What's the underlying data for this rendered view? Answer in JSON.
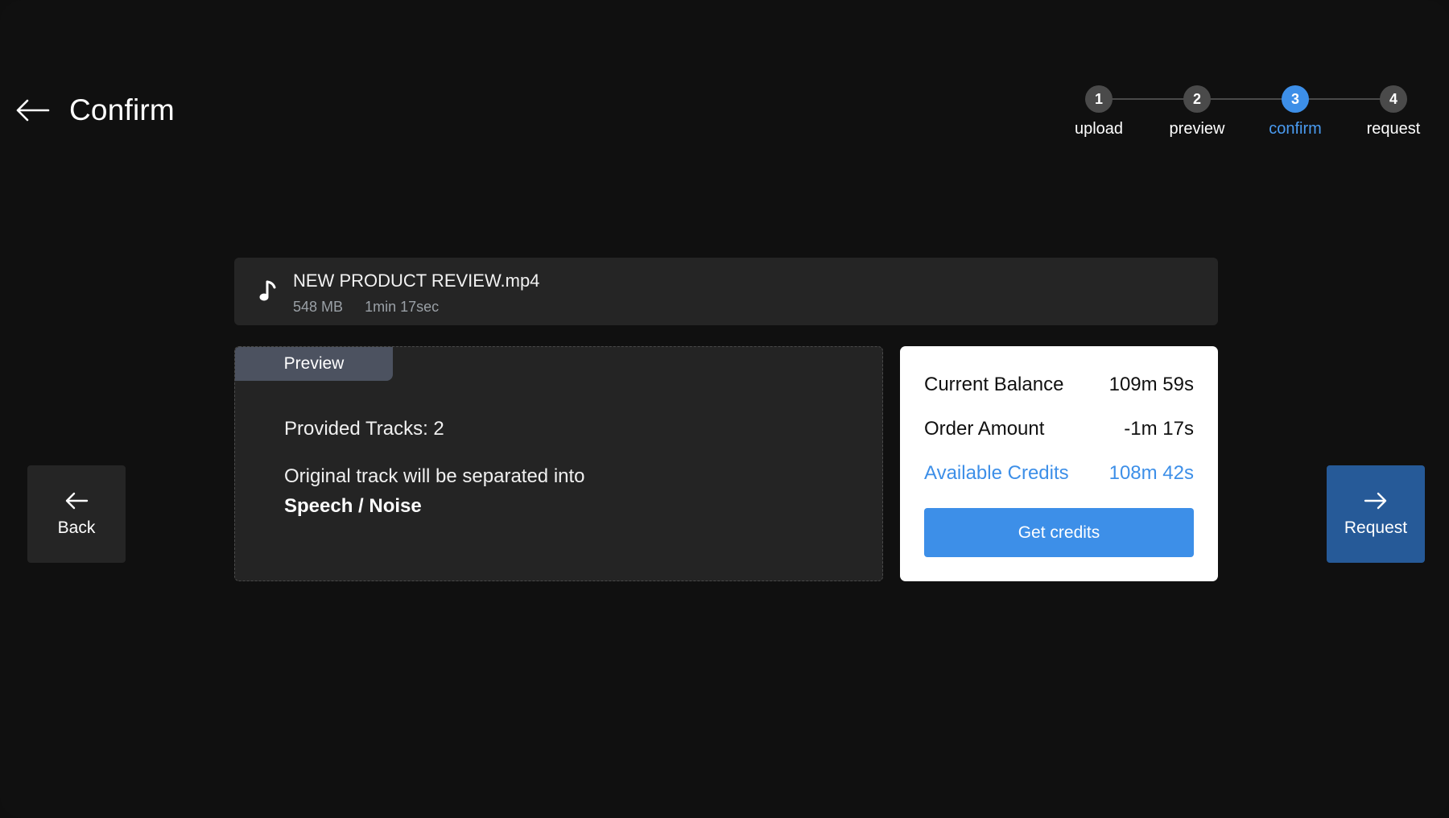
{
  "header": {
    "title": "Confirm",
    "back_icon": "arrow-left-icon"
  },
  "stepper": {
    "steps": [
      {
        "number": "1",
        "label": "upload"
      },
      {
        "number": "2",
        "label": "preview"
      },
      {
        "number": "3",
        "label": "confirm",
        "active": true
      },
      {
        "number": "4",
        "label": "request"
      }
    ],
    "active_color": "#3d8fe8"
  },
  "file": {
    "icon": "music-note-icon",
    "name": "NEW PRODUCT REVIEW.mp4",
    "size": "548 MB",
    "duration": "1min 17sec"
  },
  "preview": {
    "tab_label": "Preview",
    "tracks_text": "Provided Tracks: 2",
    "description": "Original track will be separated into",
    "separation": "Speech / Noise"
  },
  "balance": {
    "current_label": "Current Balance",
    "current_value": "109m 59s",
    "order_label": "Order Amount",
    "order_value": "-1m 17s",
    "available_label": "Available Credits",
    "available_value": "108m 42s",
    "button_label": "Get credits",
    "accent": "#3d8fe8"
  },
  "nav": {
    "back_label": "Back",
    "request_label": "Request",
    "request_color": "#265a98"
  }
}
